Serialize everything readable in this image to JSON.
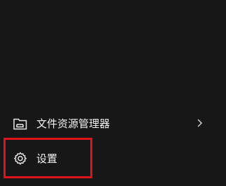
{
  "start_menu": {
    "items": [
      {
        "label": "文件资源管理器",
        "icon": "file-explorer-icon",
        "has_submenu": true
      },
      {
        "label": "设置",
        "icon": "gear-icon"
      }
    ]
  },
  "annotation": {
    "highlight_color": "#e0131a"
  }
}
